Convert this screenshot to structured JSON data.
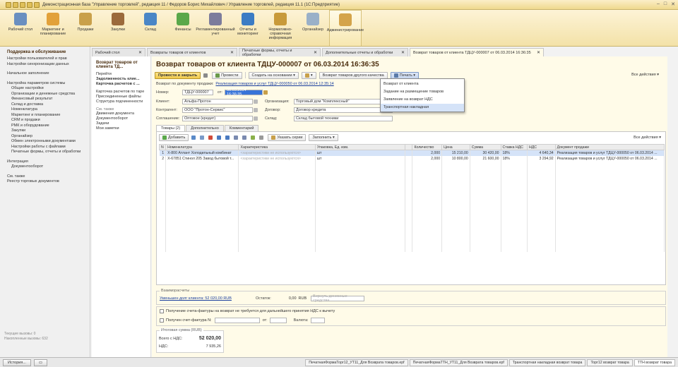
{
  "window": {
    "title": "Демонстрационная база \"Управление торговлей\", редакция 11 / Федоров Борис Михайлович / Управление торговлей, редакция 11.1  (1С:Предприятие)"
  },
  "sections": [
    {
      "label": "Рабочий стол",
      "color": "#6a8fc0"
    },
    {
      "label": "Маркетинг и планирование",
      "color": "#e2a13a"
    },
    {
      "label": "Продажи",
      "color": "#c9a04a"
    },
    {
      "label": "Закупки",
      "color": "#9b6a3c"
    },
    {
      "label": "Склад",
      "color": "#4a86c6"
    },
    {
      "label": "Финансы",
      "color": "#5aa84a"
    },
    {
      "label": "Регламентированный учет",
      "color": "#7c7c9c"
    },
    {
      "label": "Отчеты и мониторинг",
      "color": "#3c7cc4"
    },
    {
      "label": "Нормативно-справочная информация",
      "color": "#c89a3a"
    },
    {
      "label": "Органайзер",
      "color": "#9ab0c8"
    },
    {
      "label": "Администрирование",
      "color": "#d4a44a"
    }
  ],
  "sidebar": {
    "group1": "Поддержка и обслуживание",
    "items_a": [
      "Настройки пользователей и прав",
      "Настройки синхронизации данных"
    ],
    "item_b": "Начальное заполнение",
    "item_c": "Настройка параметров системы",
    "subitems": [
      "Общие настройки",
      "Организации и денежные средства",
      "Финансовый результат",
      "Склад и доставка",
      "Номенклатура",
      "Маркетинг и планирование",
      "CRM и продажи",
      "РМК и оборудование",
      "Закупки",
      "Органайзер",
      "Обмен электронными документами",
      "Настройки работы с файлами",
      "Печатные формы, отчеты и обработки"
    ],
    "group2": "Интеграция",
    "group2_items": [
      "Документооборот"
    ],
    "seealso": "См. также",
    "seealso_items": [
      "Реестр торговых документов"
    ],
    "calls_current": "Текущие вызовы: 0",
    "calls_accum": "Накопленные вызовы: 632"
  },
  "tabs": [
    {
      "label": "Рабочий стол"
    },
    {
      "label": "Возвраты товаров от клиентов"
    },
    {
      "label": "Печатные формы, отчеты и обработки"
    },
    {
      "label": "Дополнительные отчеты и обработки"
    },
    {
      "label": "Возврат товаров от клиента ТДЦУ-000007 от 06.03.2014 16:36:35"
    }
  ],
  "nav": {
    "title": "Возврат товаров от клиента ТД...",
    "goto": "Перейти",
    "bold_items": [
      "Задолженность клие...",
      "Карточка расчетов с ..."
    ],
    "items": [
      "Карточка расчетов по таре",
      "Присоединенные файлы",
      "Структура подчиненности"
    ],
    "seealso": "См. также",
    "seealso_items": [
      "Движения документа",
      "Документооборот",
      "Задачи",
      "Мои заметки"
    ]
  },
  "form": {
    "title": "Возврат товаров от клиента ТДЦУ-000007 от 06.03.2014 16:36:35",
    "toolbar": {
      "post_close": "Провести и закрыть",
      "post": "Провести",
      "create_based": "Создать на основании",
      "return_other": "Возврат товаров другого качества",
      "print": "Печать",
      "all_actions": "Все действия"
    },
    "based_on_label": "Возврат по документу продажи:",
    "based_on_link": "Реализация товаров и услуг ТДЦУ-000050 от 06.03.2014 12:35:14",
    "number_label": "Номер:",
    "number": "ТДЦУ-000007",
    "from_label": "от:",
    "date": "06.03.2014 16:36:35",
    "client_label": "Клиент:",
    "client": "Альфа-Протон",
    "org_label": "Организация:",
    "org": "Торговый дом \"Комплексный\"",
    "contractor_label": "Контрагент:",
    "contractor": "ООО \"Протон-Сервис\"",
    "contract_label": "Договор:",
    "contract": "Договор кредита",
    "agreement_label": "Соглашение:",
    "agreement": "Оптовое (кредит)",
    "warehouse_label": "Склад:",
    "warehouse": "Склад бытовой техники"
  },
  "print_menu": {
    "items": [
      "Возврат от клиента",
      "Задание на размещение товаров",
      "Заявление на возврат НДС",
      "Транспортная накладная"
    ],
    "highlighted": 3
  },
  "subtabs": [
    "Товары (2)",
    "Дополнительно",
    "Комментарий"
  ],
  "grid": {
    "add": "Добавить",
    "serials": "Указать серии",
    "fill": "Заполнить",
    "all_actions": "Все действия",
    "columns": [
      "N",
      "Номенклатура",
      "Характеристика",
      "Упаковка, Ед. изм.",
      "",
      "Количество",
      "Цена",
      "Сумма",
      "Ставка НДС",
      "НДС",
      "Документ продажи"
    ],
    "rows": [
      {
        "n": "1",
        "item": "Х-800 Атлант Холодильный комбинат",
        "char": "<характеристики не используются>",
        "unit": "шт",
        "qty": "2,000",
        "price": "15 210,00",
        "sum": "30 420,00",
        "rate": "18%",
        "vat": "4 640,34",
        "doc": "Реализация товаров и услуг ТДЦУ-000050 от 06.03.2014 ..."
      },
      {
        "n": "2",
        "item": "Х-67851 Стинол 205 Завод бытовой т...",
        "char": "<характеристики не используются>",
        "unit": "шт",
        "qty": "2,000",
        "price": "10 800,00",
        "sum": "21 600,00",
        "rate": "18%",
        "vat": "3 294,92",
        "doc": "Реализация товаров и услуг ТДЦУ-000050 от 06.03.2014 ..."
      }
    ]
  },
  "settlements": {
    "title": "Взаиморасчеты",
    "debt_link": "Уменьшен долг клиента: 52 020,00 RUB",
    "remain_label": "Остаток:",
    "remain": "0,00",
    "currency": "RUB",
    "refund_placeholder": "Вернуть денежные средства"
  },
  "invoice": {
    "no_invoice": "Получение счета-фактуры на возврат не требуется для дальнейшего принятия НДС к вычету",
    "received": "Получен счет-фактура N:",
    "from": "от:",
    "amount": "Валюта:"
  },
  "totals": {
    "title": "Итоговая сумма (RUB)",
    "total_label": "Всего с НДС:",
    "total": "52 020,00",
    "vat_label": "НДС:",
    "vat": "7 935,26"
  },
  "taskbar": {
    "history": "История...",
    "tasks": [
      "ПечатнаяФормаТорг12_УТ11_Для Возврата товаров.epf",
      "ПечатнаяФормаТТН_УТ11_Для Возврата товаров.epf",
      "Транспортная накладная возврат товара",
      "Торг12 возврат товара",
      "ТТН возврат товара"
    ]
  }
}
